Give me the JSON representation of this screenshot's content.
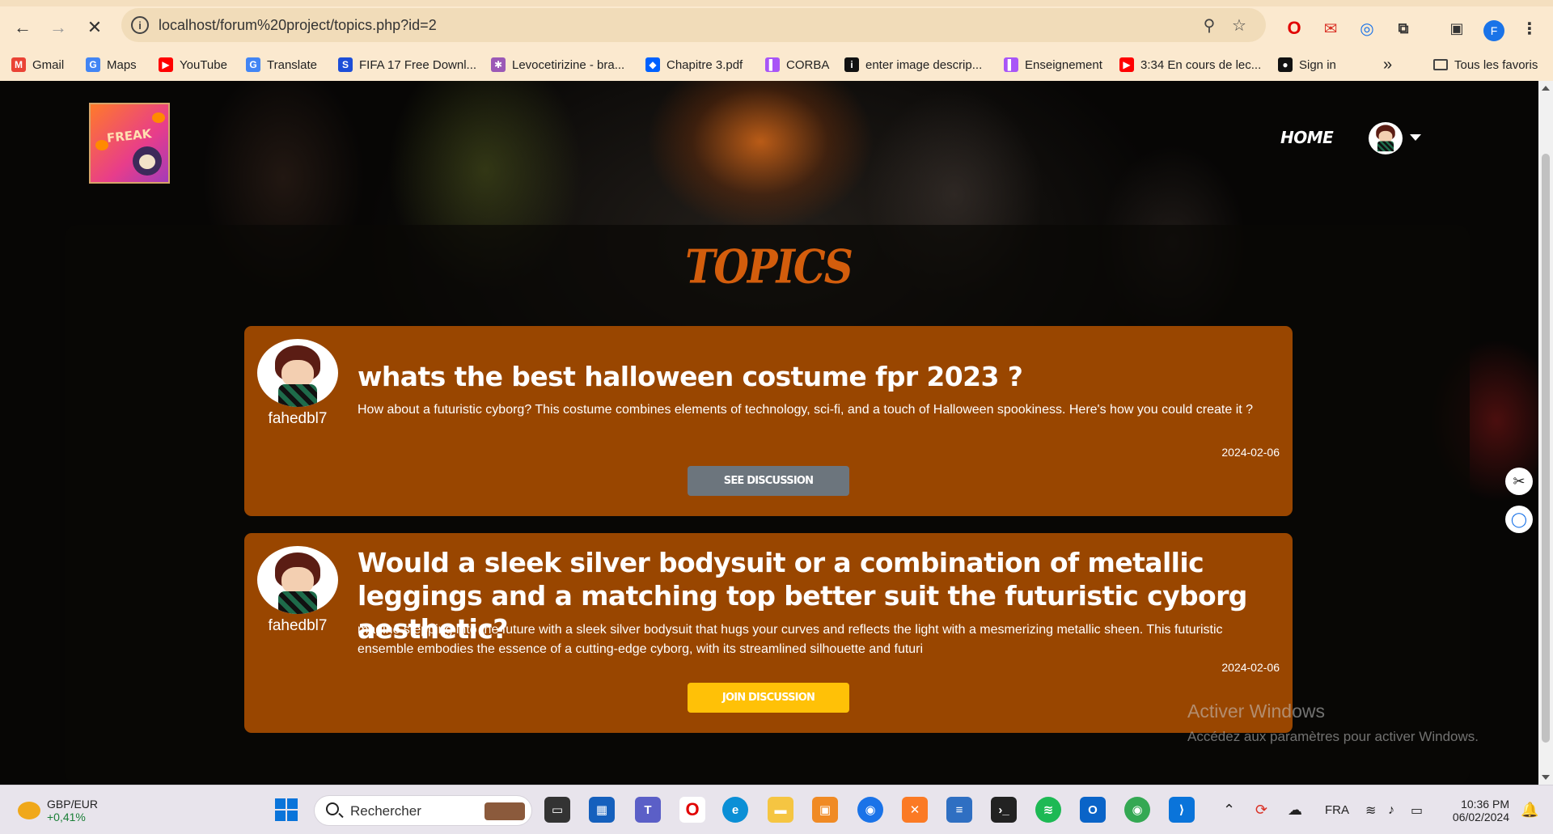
{
  "browser": {
    "url": "localhost/forum%20project/topics.php?id=2",
    "profile_initial": "F",
    "bookmarks": [
      {
        "label": "Gmail",
        "icon": "gmail-icon",
        "color": "#ea4335"
      },
      {
        "label": "Maps",
        "icon": "google-icon",
        "color": "#4285f4"
      },
      {
        "label": "YouTube",
        "icon": "youtube-icon",
        "color": "#ff0000"
      },
      {
        "label": "Translate",
        "icon": "translate-icon",
        "color": "#4285f4"
      },
      {
        "label": "FIFA 17 Free Downl...",
        "icon": "s-icon",
        "color": "#1d4ed8"
      },
      {
        "label": "Levocetirizine - bra...",
        "icon": "molecule-icon",
        "color": "#9b59b6"
      },
      {
        "label": "Chapitre 3.pdf",
        "icon": "dropbox-icon",
        "color": "#0061ff"
      },
      {
        "label": "CORBA",
        "icon": "bookmark-icon",
        "color": "#a855f7"
      },
      {
        "label": "enter image descrip...",
        "icon": "info-icon",
        "color": "#111111"
      },
      {
        "label": "Enseignement",
        "icon": "bookmark-icon",
        "color": "#a855f7"
      },
      {
        "label": "3:34 En cours de lec...",
        "icon": "youtube-icon",
        "color": "#ff0000"
      },
      {
        "label": "Sign in",
        "icon": "github-icon",
        "color": "#111111"
      }
    ],
    "more": "»",
    "all_favorites": "Tous les favoris"
  },
  "site": {
    "logo_text": "FREAK",
    "nav_home": "HOME",
    "page_title": "TOPICS"
  },
  "topics": [
    {
      "user": "fahedbl7",
      "title": "whats the best halloween costume fpr 2023 ?",
      "description": "How about a futuristic cyborg? This costume combines elements of technology, sci-fi, and a touch of Halloween spookiness. Here's how you could create it ?",
      "date": "2024-02-06",
      "button": "See discussion",
      "button_color": "#6c757d",
      "button_text_color": "#ffffff"
    },
    {
      "user": "fahedbl7",
      "title": "Would a sleek silver bodysuit or a combination of metallic leggings and a matching top better suit the futuristic cyborg aesthetic?",
      "description": "magine stepping into the future with a sleek silver bodysuit that hugs your curves and reflects the light with a mesmerizing metallic sheen. This futuristic ensemble embodies the essence of a cutting-edge cyborg, with its streamlined silhouette and futuri",
      "date": "2024-02-06",
      "button": "Join discussion",
      "button_color": "#ffc107",
      "button_text_color": "#ffffff"
    }
  ],
  "watermark": {
    "line1": "Activer Windows",
    "line2": "Accédez aux paramètres pour activer Windows."
  },
  "taskbar": {
    "ticker_name": "GBP/EUR",
    "ticker_value": "+0,41%",
    "search_placeholder": "Rechercher",
    "language": "FRA",
    "time": "10:36 PM",
    "date": "06/02/2024"
  },
  "colors": {
    "card": "#994600",
    "title_orange": "#d35d0c",
    "chrome": "#fbe9cf"
  }
}
